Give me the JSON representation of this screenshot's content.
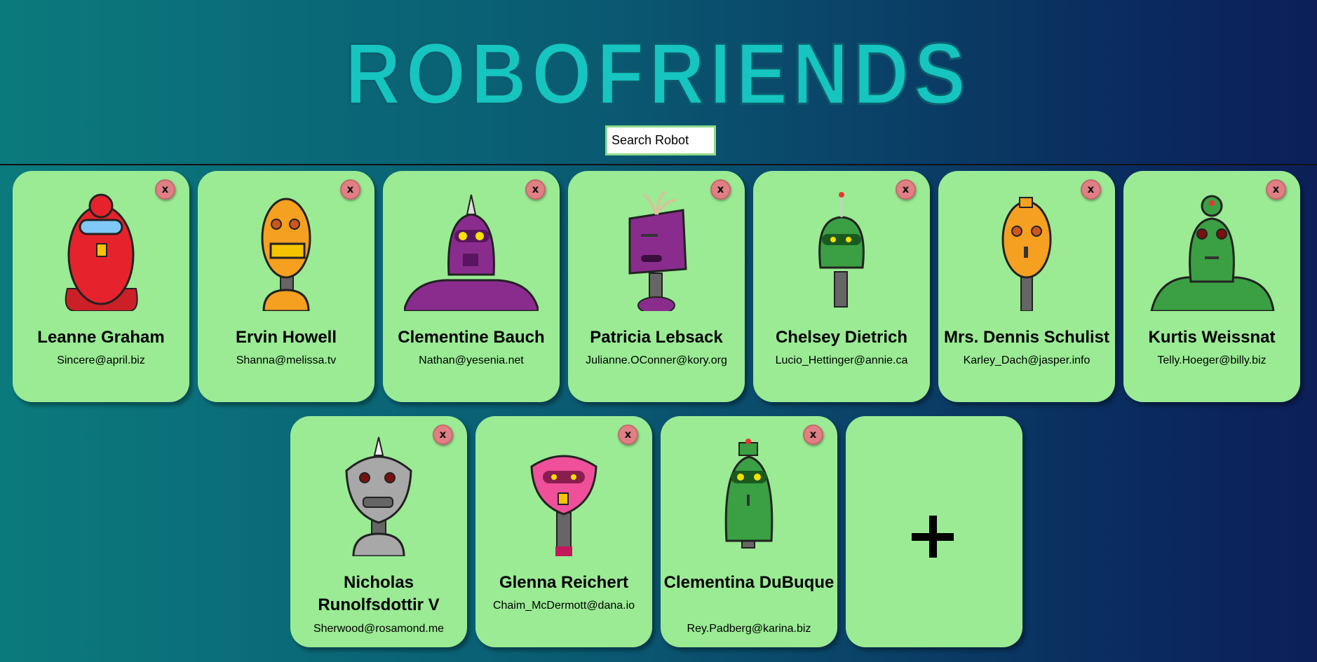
{
  "app": {
    "title": "ROBOFRIENDS"
  },
  "search": {
    "placeholder": "Search Robot"
  },
  "robots": [
    {
      "name": "Leanne Graham",
      "email": "Sincere@april.biz",
      "color": "#e6232c",
      "remove_label": "x"
    },
    {
      "name": "Ervin Howell",
      "email": "Shanna@melissa.tv",
      "color": "#f5a020",
      "remove_label": "x"
    },
    {
      "name": "Clementine Bauch",
      "email": "Nathan@yesenia.net",
      "color": "#8a2c8e",
      "remove_label": "x"
    },
    {
      "name": "Patricia Lebsack",
      "email": "Julianne.OConner@kory.org",
      "color": "#8a2c8e",
      "remove_label": "x"
    },
    {
      "name": "Chelsey Dietrich",
      "email": "Lucio_Hettinger@annie.ca",
      "color": "#3aa043",
      "remove_label": "x"
    },
    {
      "name": "Mrs. Dennis Schulist",
      "email": "Karley_Dach@jasper.info",
      "color": "#f5a020",
      "remove_label": "x"
    },
    {
      "name": "Kurtis Weissnat",
      "email": "Telly.Hoeger@billy.biz",
      "color": "#3aa043",
      "remove_label": "x"
    },
    {
      "name": "Nicholas Runolfsdottir V",
      "email": "Sherwood@rosamond.me",
      "color": "#a8a8a8",
      "remove_label": "x"
    },
    {
      "name": "Glenna Reichert",
      "email": "Chaim_McDermott@dana.io",
      "color": "#f0509a",
      "remove_label": "x"
    },
    {
      "name": "Clementina DuBuque",
      "email": "Rey.Padberg@karina.biz",
      "color": "#3aa043",
      "remove_label": "x"
    }
  ],
  "add_card": {
    "icon": "plus-icon"
  },
  "colors": {
    "card": "#9aeb94",
    "logo": "#18c8c4",
    "remove_button": "#e07f84"
  }
}
